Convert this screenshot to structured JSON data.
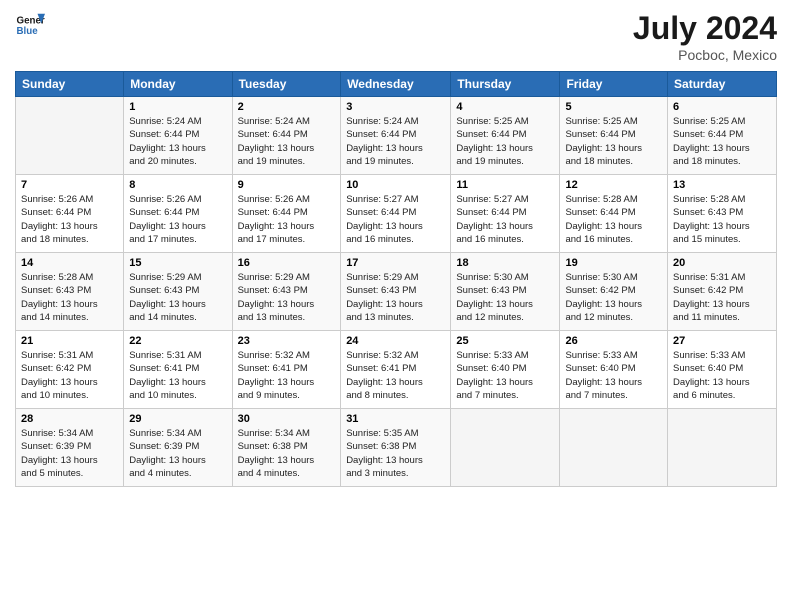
{
  "header": {
    "logo_line1": "General",
    "logo_line2": "Blue",
    "month_title": "July 2024",
    "location": "Pocboc, Mexico"
  },
  "weekdays": [
    "Sunday",
    "Monday",
    "Tuesday",
    "Wednesday",
    "Thursday",
    "Friday",
    "Saturday"
  ],
  "weeks": [
    [
      {
        "num": "",
        "info": ""
      },
      {
        "num": "1",
        "info": "Sunrise: 5:24 AM\nSunset: 6:44 PM\nDaylight: 13 hours\nand 20 minutes."
      },
      {
        "num": "2",
        "info": "Sunrise: 5:24 AM\nSunset: 6:44 PM\nDaylight: 13 hours\nand 19 minutes."
      },
      {
        "num": "3",
        "info": "Sunrise: 5:24 AM\nSunset: 6:44 PM\nDaylight: 13 hours\nand 19 minutes."
      },
      {
        "num": "4",
        "info": "Sunrise: 5:25 AM\nSunset: 6:44 PM\nDaylight: 13 hours\nand 19 minutes."
      },
      {
        "num": "5",
        "info": "Sunrise: 5:25 AM\nSunset: 6:44 PM\nDaylight: 13 hours\nand 18 minutes."
      },
      {
        "num": "6",
        "info": "Sunrise: 5:25 AM\nSunset: 6:44 PM\nDaylight: 13 hours\nand 18 minutes."
      }
    ],
    [
      {
        "num": "7",
        "info": "Sunrise: 5:26 AM\nSunset: 6:44 PM\nDaylight: 13 hours\nand 18 minutes."
      },
      {
        "num": "8",
        "info": "Sunrise: 5:26 AM\nSunset: 6:44 PM\nDaylight: 13 hours\nand 17 minutes."
      },
      {
        "num": "9",
        "info": "Sunrise: 5:26 AM\nSunset: 6:44 PM\nDaylight: 13 hours\nand 17 minutes."
      },
      {
        "num": "10",
        "info": "Sunrise: 5:27 AM\nSunset: 6:44 PM\nDaylight: 13 hours\nand 16 minutes."
      },
      {
        "num": "11",
        "info": "Sunrise: 5:27 AM\nSunset: 6:44 PM\nDaylight: 13 hours\nand 16 minutes."
      },
      {
        "num": "12",
        "info": "Sunrise: 5:28 AM\nSunset: 6:44 PM\nDaylight: 13 hours\nand 16 minutes."
      },
      {
        "num": "13",
        "info": "Sunrise: 5:28 AM\nSunset: 6:43 PM\nDaylight: 13 hours\nand 15 minutes."
      }
    ],
    [
      {
        "num": "14",
        "info": "Sunrise: 5:28 AM\nSunset: 6:43 PM\nDaylight: 13 hours\nand 14 minutes."
      },
      {
        "num": "15",
        "info": "Sunrise: 5:29 AM\nSunset: 6:43 PM\nDaylight: 13 hours\nand 14 minutes."
      },
      {
        "num": "16",
        "info": "Sunrise: 5:29 AM\nSunset: 6:43 PM\nDaylight: 13 hours\nand 13 minutes."
      },
      {
        "num": "17",
        "info": "Sunrise: 5:29 AM\nSunset: 6:43 PM\nDaylight: 13 hours\nand 13 minutes."
      },
      {
        "num": "18",
        "info": "Sunrise: 5:30 AM\nSunset: 6:43 PM\nDaylight: 13 hours\nand 12 minutes."
      },
      {
        "num": "19",
        "info": "Sunrise: 5:30 AM\nSunset: 6:42 PM\nDaylight: 13 hours\nand 12 minutes."
      },
      {
        "num": "20",
        "info": "Sunrise: 5:31 AM\nSunset: 6:42 PM\nDaylight: 13 hours\nand 11 minutes."
      }
    ],
    [
      {
        "num": "21",
        "info": "Sunrise: 5:31 AM\nSunset: 6:42 PM\nDaylight: 13 hours\nand 10 minutes."
      },
      {
        "num": "22",
        "info": "Sunrise: 5:31 AM\nSunset: 6:41 PM\nDaylight: 13 hours\nand 10 minutes."
      },
      {
        "num": "23",
        "info": "Sunrise: 5:32 AM\nSunset: 6:41 PM\nDaylight: 13 hours\nand 9 minutes."
      },
      {
        "num": "24",
        "info": "Sunrise: 5:32 AM\nSunset: 6:41 PM\nDaylight: 13 hours\nand 8 minutes."
      },
      {
        "num": "25",
        "info": "Sunrise: 5:33 AM\nSunset: 6:40 PM\nDaylight: 13 hours\nand 7 minutes."
      },
      {
        "num": "26",
        "info": "Sunrise: 5:33 AM\nSunset: 6:40 PM\nDaylight: 13 hours\nand 7 minutes."
      },
      {
        "num": "27",
        "info": "Sunrise: 5:33 AM\nSunset: 6:40 PM\nDaylight: 13 hours\nand 6 minutes."
      }
    ],
    [
      {
        "num": "28",
        "info": "Sunrise: 5:34 AM\nSunset: 6:39 PM\nDaylight: 13 hours\nand 5 minutes."
      },
      {
        "num": "29",
        "info": "Sunrise: 5:34 AM\nSunset: 6:39 PM\nDaylight: 13 hours\nand 4 minutes."
      },
      {
        "num": "30",
        "info": "Sunrise: 5:34 AM\nSunset: 6:38 PM\nDaylight: 13 hours\nand 4 minutes."
      },
      {
        "num": "31",
        "info": "Sunrise: 5:35 AM\nSunset: 6:38 PM\nDaylight: 13 hours\nand 3 minutes."
      },
      {
        "num": "",
        "info": ""
      },
      {
        "num": "",
        "info": ""
      },
      {
        "num": "",
        "info": ""
      }
    ]
  ]
}
